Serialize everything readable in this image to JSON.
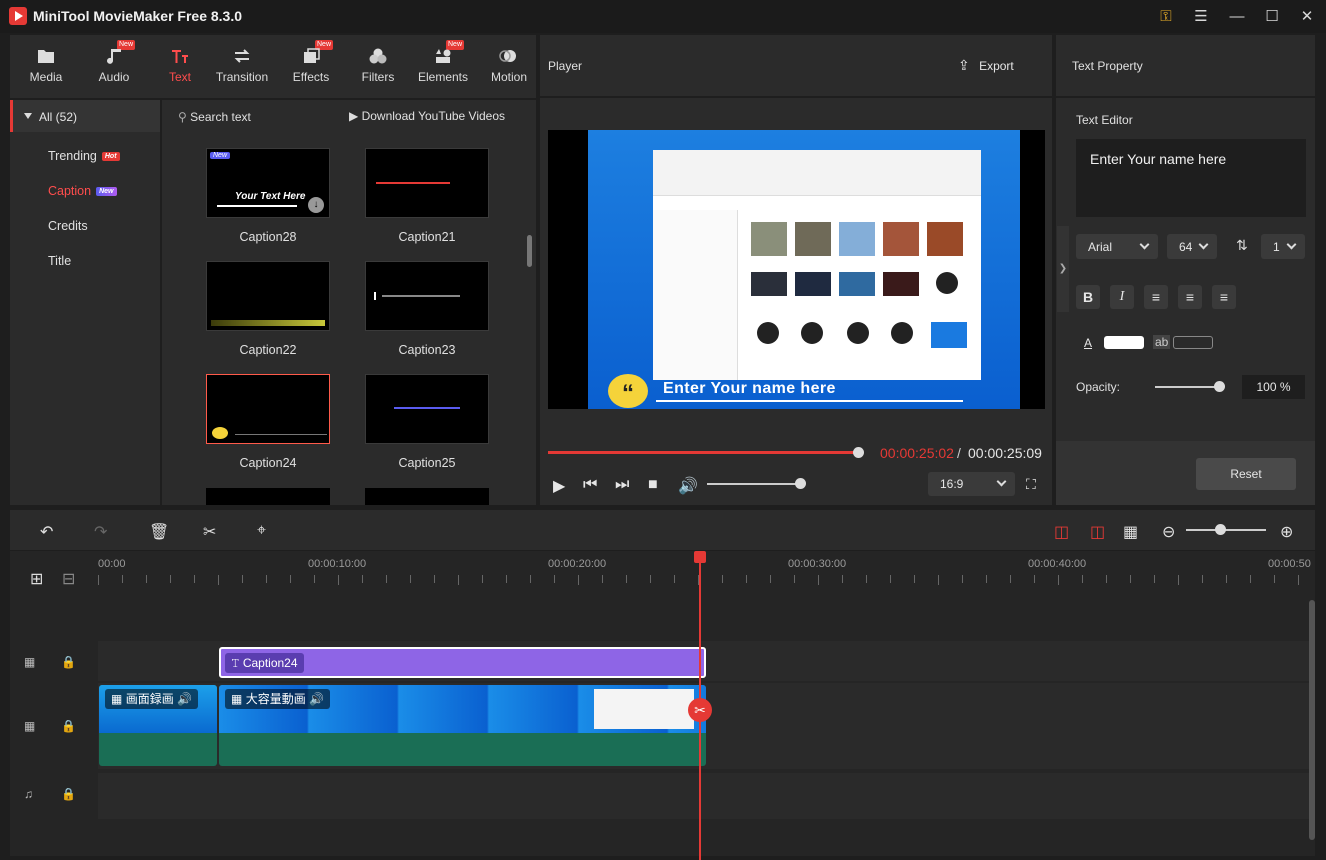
{
  "app": {
    "title": "MiniTool MovieMaker Free 8.3.0"
  },
  "toolbar": {
    "tabs": [
      {
        "label": "Media",
        "icon": "folder-icon",
        "new": false
      },
      {
        "label": "Audio",
        "icon": "music-note-icon",
        "new": true
      },
      {
        "label": "Text",
        "icon": "text-tt-icon",
        "new": false,
        "active": true
      },
      {
        "label": "Transition",
        "icon": "transition-arrows-icon",
        "new": false
      },
      {
        "label": "Effects",
        "icon": "effects-icon",
        "new": true
      },
      {
        "label": "Filters",
        "icon": "filters-circles-icon",
        "new": false
      },
      {
        "label": "Elements",
        "icon": "elements-shapes-icon",
        "new": true
      },
      {
        "label": "Motion",
        "icon": "motion-icon",
        "new": false
      }
    ],
    "new_badge": "New"
  },
  "categories": {
    "all": "All (52)",
    "items": [
      {
        "label": "Trending",
        "badge": "Hot"
      },
      {
        "label": "Caption",
        "badge": "New",
        "active": true
      },
      {
        "label": "Credits",
        "badge": ""
      },
      {
        "label": "Title",
        "badge": ""
      }
    ]
  },
  "library": {
    "search_placeholder": "Search text",
    "youtube_label": "Download YouTube Videos",
    "thumb_badge": "New",
    "thumb_sample_text": "Your Text Here",
    "items": [
      {
        "label": "Caption28"
      },
      {
        "label": "Caption21"
      },
      {
        "label": "Caption22"
      },
      {
        "label": "Caption23"
      },
      {
        "label": "Caption24",
        "selected": true
      },
      {
        "label": "Caption25"
      }
    ]
  },
  "player": {
    "title": "Player",
    "export_label": "Export",
    "caption_text": "Enter Your name here",
    "time_current": "00:00:25:02",
    "time_separator": "/",
    "time_total": "00:00:25:09",
    "aspect_ratio": "16:9",
    "progress": 0.99,
    "volume": 0.9
  },
  "text_property": {
    "title": "Text Property",
    "editor_label": "Text Editor",
    "editor_value": "Enter Your name here",
    "font": "Arial",
    "size": "64",
    "line_spacing": "1",
    "format_buttons": [
      "B",
      "I"
    ],
    "color_label": "A",
    "bg_label": "ab",
    "opacity_label": "Opacity:",
    "opacity_value": "100 %",
    "reset_label": "Reset",
    "colors": {
      "text": "#ffffff",
      "background": "#2b2b2b"
    }
  },
  "timeline": {
    "ruler": [
      "00:00",
      "00:00:10:00",
      "00:00:20:00",
      "00:00:30:00",
      "00:00:40:00",
      "00:00:50"
    ],
    "caption_clip": "Caption24",
    "video_clips": [
      "画面録画",
      "大容量動画"
    ]
  },
  "colors": {
    "accent": "#e53935",
    "caption_clip": "#8e65e6",
    "video_clip": "#1a6e55"
  }
}
